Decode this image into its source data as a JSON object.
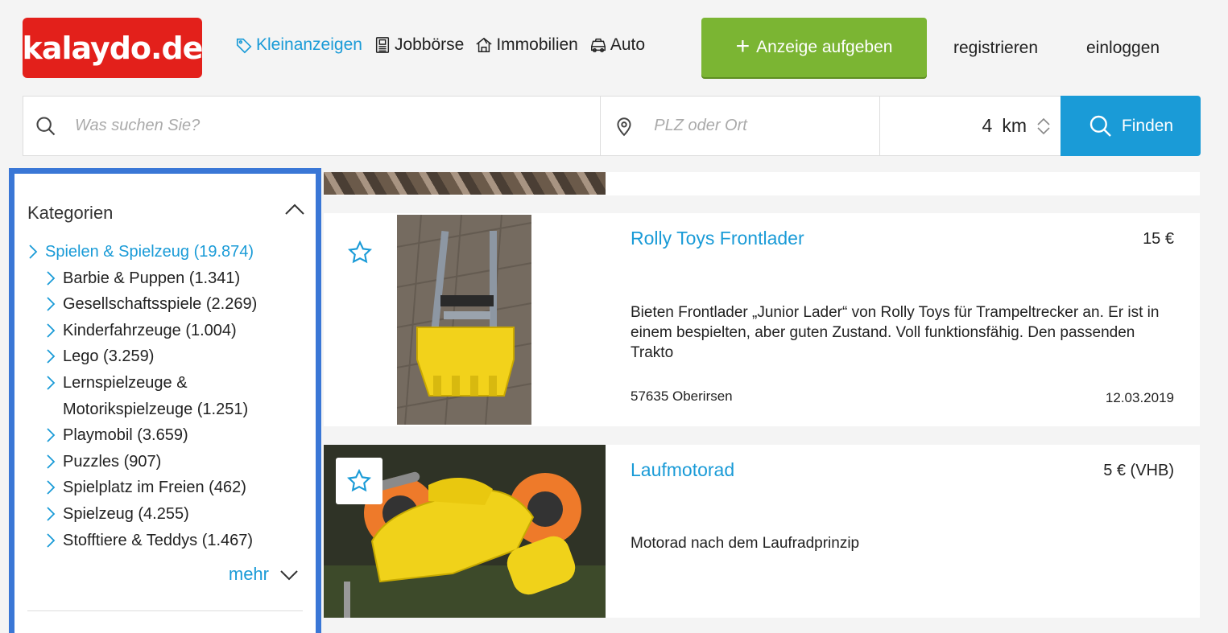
{
  "header": {
    "logo": "kalaydo.de",
    "nav": [
      {
        "label": "Kleinanzeigen",
        "icon": "tag-icon",
        "active": true
      },
      {
        "label": "Jobbörse",
        "icon": "id-card-icon",
        "active": false
      },
      {
        "label": "Immobilien",
        "icon": "house-icon",
        "active": false
      },
      {
        "label": "Auto",
        "icon": "car-icon",
        "active": false
      }
    ],
    "cta_label": "Anzeige aufgeben",
    "register_label": "registrieren",
    "login_label": "einloggen"
  },
  "search": {
    "query_placeholder": "Was suchen Sie?",
    "location_placeholder": "PLZ oder Ort",
    "distance_value": "4",
    "distance_unit": "km",
    "find_label": "Finden"
  },
  "sidebar": {
    "title": "Kategorien",
    "top_category": "Spielen & Spielzeug (19.874)",
    "items": [
      "Barbie & Puppen (1.341)",
      "Gesellschaftsspiele (2.269)",
      "Kinderfahrzeuge (1.004)",
      "Lego (3.259)",
      "Lernspielzeuge & Motorikspielzeuge (1.251)",
      "Playmobil (3.659)",
      "Puzzles (907)",
      "Spielplatz im Freien (462)",
      "Spielzeug (4.255)",
      "Stofftiere & Teddys (1.467)"
    ],
    "more_label": "mehr"
  },
  "listings": [
    {
      "title": "Rolly Toys Frontlader",
      "price": "15 €",
      "description": "Bieten Frontlader „Junior Lader“ von Rolly Toys für Trampeltrecker an. Er ist in einem bespielten, aber guten Zustand. Voll funktionsfähig. Den passenden Trakto",
      "location": "57635 Oberirsen",
      "date": "12.03.2019"
    },
    {
      "title": "Laufmotorad",
      "price": "5 € (VHB)",
      "description": "Motorad nach dem Laufradprinzip"
    }
  ],
  "colors": {
    "brand_red": "#e3201b",
    "accent_blue": "#1a9bd7",
    "cta_green": "#7bb533",
    "highlight_border": "#3a77d6"
  }
}
